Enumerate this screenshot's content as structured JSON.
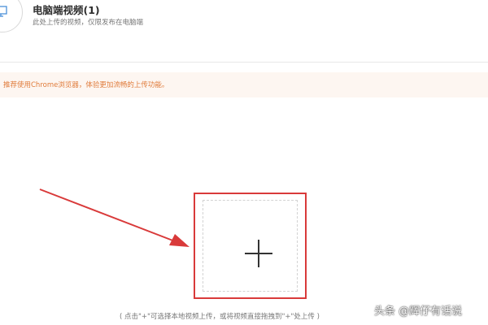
{
  "header": {
    "title": "电脑端视频(1)",
    "subtitle": "此处上传的视频，仅限发布在电脑端",
    "icon": "monitor-icon"
  },
  "notice": {
    "text": "推荐使用Chrome浏览器，体验更加流畅的上传功能。",
    "color": "#e07b3a",
    "background": "#fdf6f1"
  },
  "upload": {
    "icon": "plus-icon",
    "hint": "( 点击\"+\"可选择本地视频上传，或将视频直接拖拽到\"+\"处上传 )",
    "highlight_color": "#d93a3a"
  },
  "annotation": {
    "arrow_icon": "arrow-icon",
    "color": "#d93a3a"
  },
  "watermark": {
    "text": "头条 @辉仔有话说"
  }
}
